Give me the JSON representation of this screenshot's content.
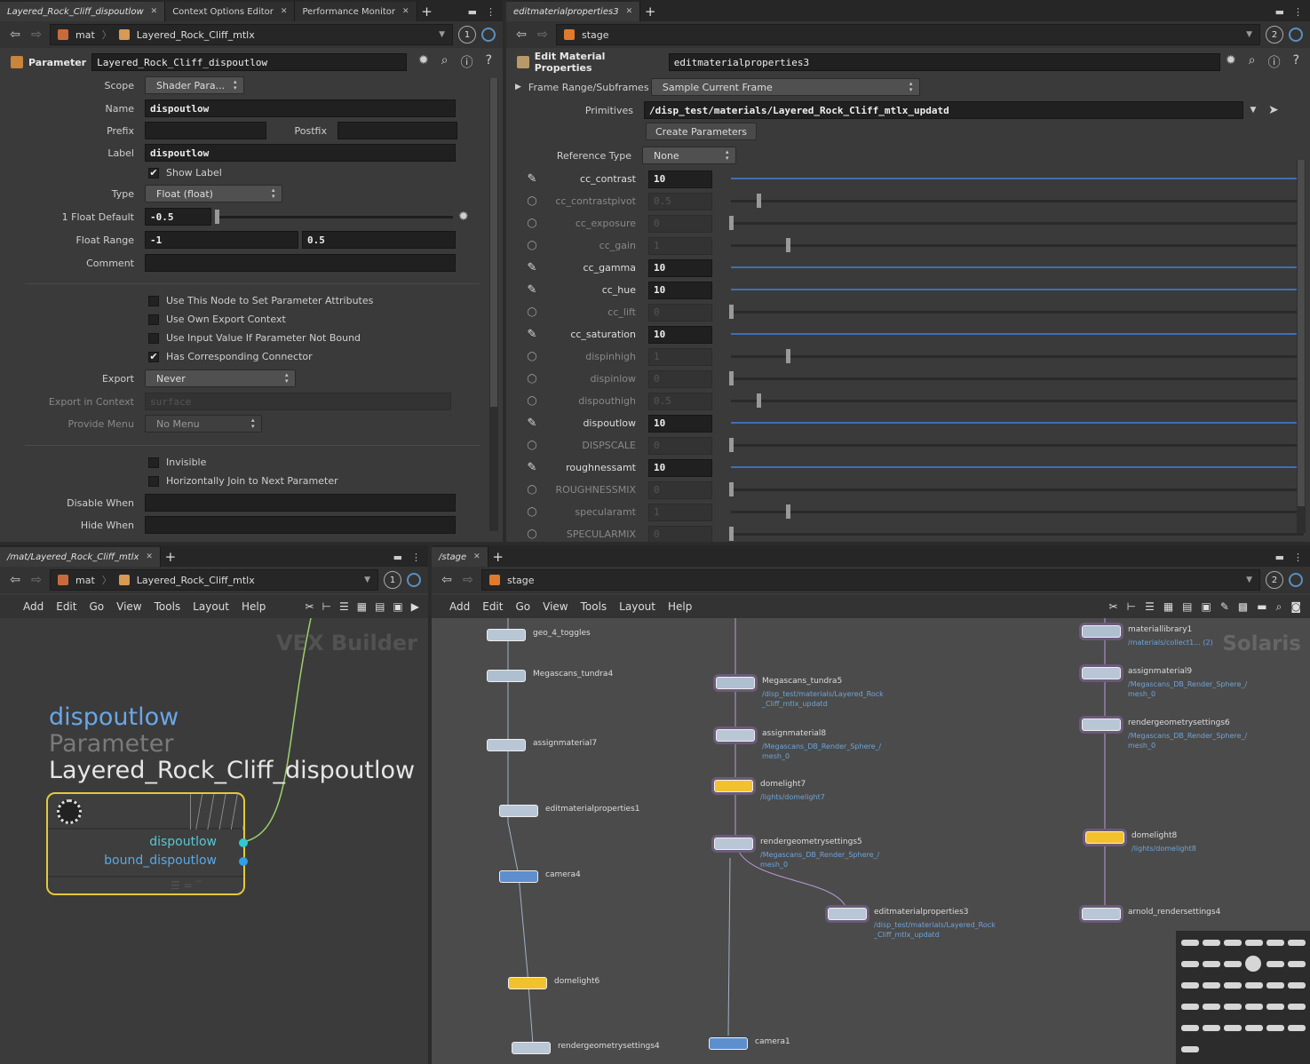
{
  "top_left": {
    "tabs": [
      "Layered_Rock_Cliff_dispoutlow",
      "Context Options Editor",
      "Performance Monitor"
    ],
    "path": {
      "context": "mat",
      "node": "Layered_Rock_Cliff_mtlx"
    },
    "pane_number": "1",
    "header_label": "Parameter",
    "header_value": "Layered_Rock_Cliff_dispoutlow",
    "scope": {
      "label": "Scope",
      "value": "Shader Para..."
    },
    "name": {
      "label": "Name",
      "value": "dispoutlow"
    },
    "prefix_label": "Prefix",
    "postfix_label": "Postfix",
    "label_row": {
      "label": "Label",
      "value": "dispoutlow"
    },
    "show_label": "Show Label",
    "type": {
      "label": "Type",
      "value": "Float (float)"
    },
    "float_default": {
      "label": "1 Float Default",
      "value": "-0.5"
    },
    "float_range": {
      "label": "Float Range",
      "min": "-1",
      "max": "0.5"
    },
    "comment_label": "Comment",
    "checks": [
      "Use This Node to Set Parameter Attributes",
      "Use Own Export Context",
      "Use Input Value If Parameter Not Bound",
      "Has Corresponding Connector"
    ],
    "export": {
      "label": "Export",
      "value": "Never"
    },
    "export_context": {
      "label": "Export in Context",
      "value": "surface"
    },
    "provide_menu": {
      "label": "Provide Menu",
      "value": "No Menu"
    },
    "invisible": "Invisible",
    "join": "Horizontally Join to Next Parameter",
    "disable_when": "Disable When",
    "hide_when": "Hide When"
  },
  "top_right": {
    "tab": "editmaterialproperties3",
    "path": "stage",
    "pane_number": "2",
    "header_label": "Edit Material Properties",
    "header_value": "editmaterialproperties3",
    "frame_range": {
      "label": "Frame Range/Subframes",
      "value": "Sample Current Frame"
    },
    "primitives": {
      "label": "Primitives",
      "value": "/disp_test/materials/Layered_Rock_Cliff_mtlx_updatd"
    },
    "create_button": "Create Parameters",
    "reference_type": {
      "label": "Reference Type",
      "value": "None"
    },
    "params": [
      {
        "name": "cc_contrast",
        "value": "10",
        "on": true,
        "level": 1.0
      },
      {
        "name": "cc_contrastpivot",
        "value": "0.5",
        "on": false,
        "level": 0.05
      },
      {
        "name": "cc_exposure",
        "value": "0",
        "on": false,
        "level": 0.0
      },
      {
        "name": "cc_gain",
        "value": "1",
        "on": false,
        "level": 0.1
      },
      {
        "name": "cc_gamma",
        "value": "10",
        "on": true,
        "level": 1.0
      },
      {
        "name": "cc_hue",
        "value": "10",
        "on": true,
        "level": 1.0
      },
      {
        "name": "cc_lift",
        "value": "0",
        "on": false,
        "level": 0.0
      },
      {
        "name": "cc_saturation",
        "value": "10",
        "on": true,
        "level": 1.0
      },
      {
        "name": "dispinhigh",
        "value": "1",
        "on": false,
        "level": 0.1
      },
      {
        "name": "dispinlow",
        "value": "0",
        "on": false,
        "level": 0.0
      },
      {
        "name": "dispouthigh",
        "value": "0.5",
        "on": false,
        "level": 0.05
      },
      {
        "name": "dispoutlow",
        "value": "10",
        "on": true,
        "level": 1.0
      },
      {
        "name": "DISPSCALE",
        "value": "0",
        "on": false,
        "level": 0.0
      },
      {
        "name": "roughnessamt",
        "value": "10",
        "on": true,
        "level": 1.0
      },
      {
        "name": "ROUGHNESSMIX",
        "value": "0",
        "on": false,
        "level": 0.0
      },
      {
        "name": "specularamt",
        "value": "1",
        "on": false,
        "level": 0.1
      },
      {
        "name": "SPECULARMIX",
        "value": "0",
        "on": false,
        "level": 0.0
      }
    ]
  },
  "bottom_left": {
    "tab": "/mat/Layered_Rock_Cliff_mtlx",
    "path": {
      "context": "mat",
      "node": "Layered_Rock_Cliff_mtlx"
    },
    "pane_number": "1",
    "menu": [
      "Add",
      "Edit",
      "Go",
      "View",
      "Tools",
      "Layout",
      "Help"
    ],
    "watermark": "VEX Builder",
    "node_title": "dispoutlow",
    "node_type": "Parameter",
    "node_path": "Layered_Rock_Cliff_dispoutlow",
    "outputs": [
      "dispoutlow",
      "bound_dispoutlow"
    ],
    "accent": "#f2ef6e"
  },
  "bottom_right": {
    "tab": "/stage",
    "path": "stage",
    "pane_number": "2",
    "menu": [
      "Add",
      "Edit",
      "Go",
      "View",
      "Tools",
      "Layout",
      "Help"
    ],
    "watermark": "Solaris",
    "nodes": [
      {
        "name": "geo_4_toggles",
        "sub": ""
      },
      {
        "name": "Megascans_tundra4",
        "sub": ""
      },
      {
        "name": "assignmaterial7",
        "sub": ""
      },
      {
        "name": "editmaterialproperties1",
        "sub": ""
      },
      {
        "name": "camera4",
        "sub": ""
      },
      {
        "name": "domelight6",
        "sub": ""
      },
      {
        "name": "rendergeometrysettings4",
        "sub": ""
      },
      {
        "name": "Megascans_tundra5",
        "sub": "/disp_test/materials/Layered_Rock\n_Cliff_mtlx_updatd"
      },
      {
        "name": "assignmaterial8",
        "sub": "/Megascans_DB_Render_Sphere_/\nmesh_0"
      },
      {
        "name": "domelight7",
        "sub": "/lights/domelight7"
      },
      {
        "name": "rendergeometrysettings5",
        "sub": "/Megascans_DB_Render_Sphere_/\nmesh_0"
      },
      {
        "name": "editmaterialproperties3",
        "sub": "/disp_test/materials/Layered_Rock\n_Cliff_mtlx_updatd"
      },
      {
        "name": "camera1",
        "sub": ""
      },
      {
        "name": "materiallibrary1",
        "sub": "/materials/collect1... (2)"
      },
      {
        "name": "assignmaterial9",
        "sub": "/Megascans_DB_Render_Sphere_/\nmesh_0"
      },
      {
        "name": "rendergeometrysettings6",
        "sub": "/Megascans_DB_Render_Sphere_/\nmesh_0"
      },
      {
        "name": "domelight8",
        "sub": "/lights/domelight8"
      },
      {
        "name": "arnold_rendersettings4",
        "sub": ""
      }
    ]
  }
}
